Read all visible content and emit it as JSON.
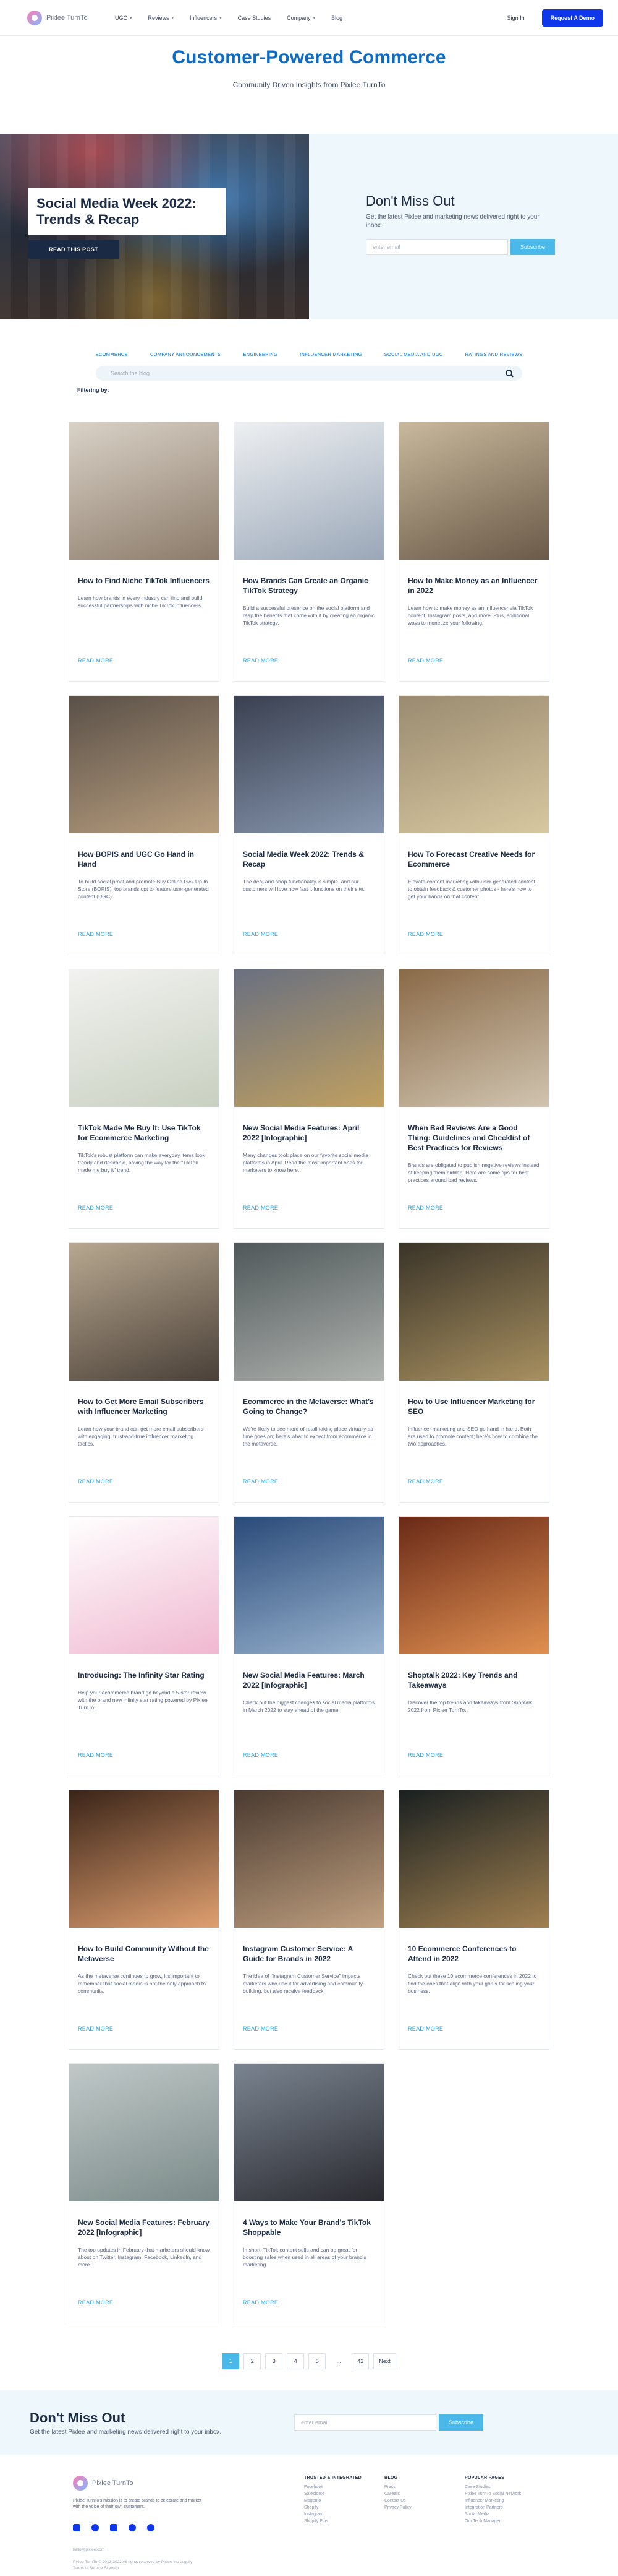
{
  "nav": {
    "logo_text": "Pixlee TurnTo",
    "links": [
      {
        "label": "UGC",
        "chevron": true
      },
      {
        "label": "Reviews",
        "chevron": true
      },
      {
        "label": "Influencers",
        "chevron": true
      },
      {
        "label": "Case Studies",
        "chevron": false
      },
      {
        "label": "Company",
        "chevron": true
      },
      {
        "label": "Blog",
        "chevron": false
      }
    ],
    "signin": "Sign In",
    "demo": "Request A Demo"
  },
  "hero": {
    "title": "Customer-Powered Commerce",
    "subtitle": "Community Driven Insights from Pixlee TurnTo"
  },
  "feature": {
    "title": "Social Media Week 2022: Trends & Recap",
    "button": "READ THIS POST",
    "side_title": "Don't Miss Out",
    "side_text": "Get the latest Pixlee and marketing news delivered right to your inbox.",
    "email_placeholder": "enter email",
    "subscribe": "Subscribe"
  },
  "filters": {
    "categories": [
      "ECOMMERCE",
      "COMPANY ANNOUNCEMENTS",
      "ENGINEERING",
      "INFLUENCER MARKETING",
      "SOCIAL MEDIA AND UGC",
      "RATINGS AND REVIEWS"
    ],
    "search_placeholder": "Search the blog",
    "filtering_label": "Filtering by:"
  },
  "posts": [
    {
      "title": "How to Find Niche TikTok Influencers",
      "excerpt": "Learn how brands in every industry can find and build successful partnerships with niche TikTok influencers.",
      "read_more": "READ MORE",
      "c1": "#d9d2c7",
      "c2": "#8c7b6a"
    },
    {
      "title": "How Brands Can Create an Organic TikTok Strategy",
      "excerpt": "Build a successful presence on the social platform and reap the benefits that come with it by creating an organic TikTok strategy.",
      "read_more": "READ MORE",
      "c1": "#eef0f2",
      "c2": "#9aa7b8"
    },
    {
      "title": "How to Make Money as an Influencer in 2022",
      "excerpt": "Learn how to make money as an influencer via TikTok content, Instagram posts, and more. Plus, additional ways to monetize your following.",
      "read_more": "READ MORE",
      "c1": "#c8b89c",
      "c2": "#6a5a48"
    },
    {
      "title": "How BOPIS and UGC Go Hand in Hand",
      "excerpt": "To build social proof and promote Buy Online Pick Up In Store (BOPIS), top brands opt to feature user-generated content (UGC).",
      "read_more": "READ MORE",
      "c1": "#5a5048",
      "c2": "#b89e7e"
    },
    {
      "title": "Social Media Week 2022: Trends & Recap",
      "excerpt": "The deal-and-shop functionality is simple, and our customers will love how fast it functions on their site.",
      "read_more": "READ MORE",
      "c1": "#3a4050",
      "c2": "#8898b0"
    },
    {
      "title": "How To Forecast Creative Needs for Ecommerce",
      "excerpt": "Elevate content marketing with user-generated content to obtain feedback & customer photos - here's how to get your hands on that content.",
      "read_more": "READ MORE",
      "c1": "#9a8a70",
      "c2": "#d8c8a0"
    },
    {
      "title": "TikTok Made Me Buy It: Use TikTok for Ecommerce Marketing",
      "excerpt": "TikTok's robust platform can make everyday items look trendy and desirable, paving the way for the \"TikTok made me buy it\" trend.",
      "read_more": "READ MORE",
      "c1": "#f2f2f0",
      "c2": "#c8d0c0"
    },
    {
      "title": "New Social Media Features: April 2022 [Infographic]",
      "excerpt": "Many changes took place on our favorite social media platforms in April. Read the most important ones for marketers to know here.",
      "read_more": "READ MORE",
      "c1": "#6a7080",
      "c2": "#c0a060"
    },
    {
      "title": "When Bad Reviews Are a Good Thing: Guidelines and Checklist of Best Practices for Reviews",
      "excerpt": "Brands are obligated to publish negative reviews instead of keeping them hidden. Here are some tips for best practices around bad reviews.",
      "read_more": "READ MORE",
      "c1": "#8a6a48",
      "c2": "#d0c4b0"
    },
    {
      "title": "How to Get More Email Subscribers with Influencer Marketing",
      "excerpt": "Learn how your brand can get more email subscribers with engaging, trust-and-true influencer marketing tactics.",
      "read_more": "READ MORE",
      "c1": "#b8a890",
      "c2": "#4a4038"
    },
    {
      "title": "Ecommerce in the Metaverse: What's Going to Change?",
      "excerpt": "We're likely to see more of retail taking place virtually as time goes on; here's what to expect from ecommerce in the metaverse.",
      "read_more": "READ MORE",
      "c1": "#50585a",
      "c2": "#b0b4b0"
    },
    {
      "title": "How to Use Influencer Marketing for SEO",
      "excerpt": "Influencer marketing and SEO go hand in hand. Both are used to promote content; here's how to combine the two approaches.",
      "read_more": "READ MORE",
      "c1": "#3a3428",
      "c2": "#a89060"
    },
    {
      "title": "Introducing: The Infinity Star Rating",
      "excerpt": "Help your ecommerce brand go beyond a 5-star review with the brand new infinity star rating powered by Pixlee TurnTo!",
      "read_more": "READ MORE",
      "c1": "#ffffff",
      "c2": "#f0b8d0"
    },
    {
      "title": "New Social Media Features: March 2022 [Infographic]",
      "excerpt": "Check out the biggest changes to social media platforms in March 2022 to stay ahead of the game.",
      "read_more": "READ MORE",
      "c1": "#2a4a78",
      "c2": "#9ab4d0"
    },
    {
      "title": "Shoptalk 2022: Key Trends and Takeaways",
      "excerpt": "Discover the top trends and takeaways from Shoptalk 2022 from Pixlee TurnTo.",
      "read_more": "READ MORE",
      "c1": "#6a2a18",
      "c2": "#e09050"
    },
    {
      "title": "How to Build Community Without the Metaverse",
      "excerpt": "As the metaverse continues to grow, it's important to remember that social media is not the only approach to community.",
      "read_more": "READ MORE",
      "c1": "#3a2418",
      "c2": "#e0a070"
    },
    {
      "title": "Instagram Customer Service: A Guide for Brands in 2022",
      "excerpt": "The idea of \"Instagram Customer Service\" impacts marketers who use it for advertising and community-building, but also receive feedback.",
      "read_more": "READ MORE",
      "c1": "#4a3a30",
      "c2": "#c0a080"
    },
    {
      "title": "10 Ecommerce Conferences to Attend in 2022",
      "excerpt": "Check out these 10 ecommerce conferences in 2022 to find the ones that align with your goals for scaling your business.",
      "read_more": "READ MORE",
      "c1": "#1a2020",
      "c2": "#a08050"
    },
    {
      "title": "New Social Media Features: February 2022 [Infographic]",
      "excerpt": "The top updates in February that marketers should know about on Twitter, Instagram, Facebook, LinkedIn, and more.",
      "read_more": "READ MORE",
      "c1": "#c0c8c8",
      "c2": "#7a8a88"
    },
    {
      "title": "4 Ways to Make Your Brand's TikTok Shoppable",
      "excerpt": "In short, TikTok content sells and can be great for boosting sales when used in all areas of your brand's marketing.",
      "read_more": "READ MORE",
      "c1": "#7a8490",
      "c2": "#2a2a30"
    }
  ],
  "pagination": {
    "pages": [
      "1",
      "2",
      "3",
      "4",
      "5",
      "...",
      "42"
    ],
    "next": "Next"
  },
  "bottom_sub": {
    "title": "Don't Miss Out",
    "text": "Get the latest Pixlee and marketing news delivered right to your inbox.",
    "email_placeholder": "enter email",
    "subscribe": "Subscribe"
  },
  "footer": {
    "logo_text": "Pixlee TurnTo",
    "brand_text": "Pixlee TurnTo's mission is to create brands to celebrate and market with the voice of their own customers.",
    "col1_title": "TRUSTED & INTEGRATED",
    "col1": [
      "Facebook",
      "Salesforce",
      "Magento",
      "Shopify",
      "Instagram",
      "Shopify Plus"
    ],
    "col2_title": "BLOG",
    "col2": [
      "Press",
      "Careers",
      "Contact Us",
      "Privacy Policy"
    ],
    "col3_title": "POPULAR PAGES",
    "col3": [
      "Case Studies",
      "Pixlee TurnTo Social Network",
      "Influencer Marketing",
      "Integration Partners",
      "Social Media",
      "Our Tech Manager"
    ],
    "small_a": "hello@pixlee.com",
    "small_b": "Pixlee TurnTo © 2013-2022 All rights reserved by Pixlee Inc Legally",
    "small_c": "Terms of Service  Sitemap"
  }
}
